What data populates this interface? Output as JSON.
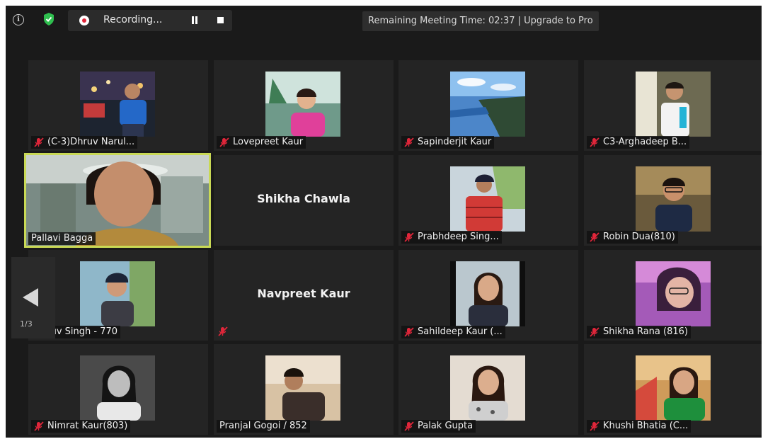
{
  "topbar": {
    "recording_label": "Recording...",
    "meeting_time": "Remaining Meeting Time: 02:37 | Upgrade to Pro"
  },
  "pager": {
    "label": "1/3"
  },
  "colors": {
    "speaking_border": "#c9d955",
    "record_red": "#e0263a",
    "mute_red": "#e0263a",
    "shield_green": "#2fbf4f"
  },
  "tiles": [
    {
      "name": "(C-3)Dhruv Narul..."
    },
    {
      "name": "Lovepreet Kaur"
    },
    {
      "name": "Sapinderjit Kaur"
    },
    {
      "name": "C3-Arghadeep B..."
    },
    {
      "name": "Pallavi Bagga"
    },
    {
      "name": "Shikha Chawla"
    },
    {
      "name": "Prabhdeep Sing..."
    },
    {
      "name": "Robin Dua(810)"
    },
    {
      "name": "Dhruv Singh - 770"
    },
    {
      "name": "Navpreet Kaur"
    },
    {
      "name": "Sahildeep Kaur (..."
    },
    {
      "name": "Shikha Rana (816)"
    },
    {
      "name": "Nimrat Kaur(803)"
    },
    {
      "name": "Pranjal Gogoi / 852"
    },
    {
      "name": "Palak Gupta"
    },
    {
      "name": "Khushi Bhatia (C..."
    }
  ]
}
